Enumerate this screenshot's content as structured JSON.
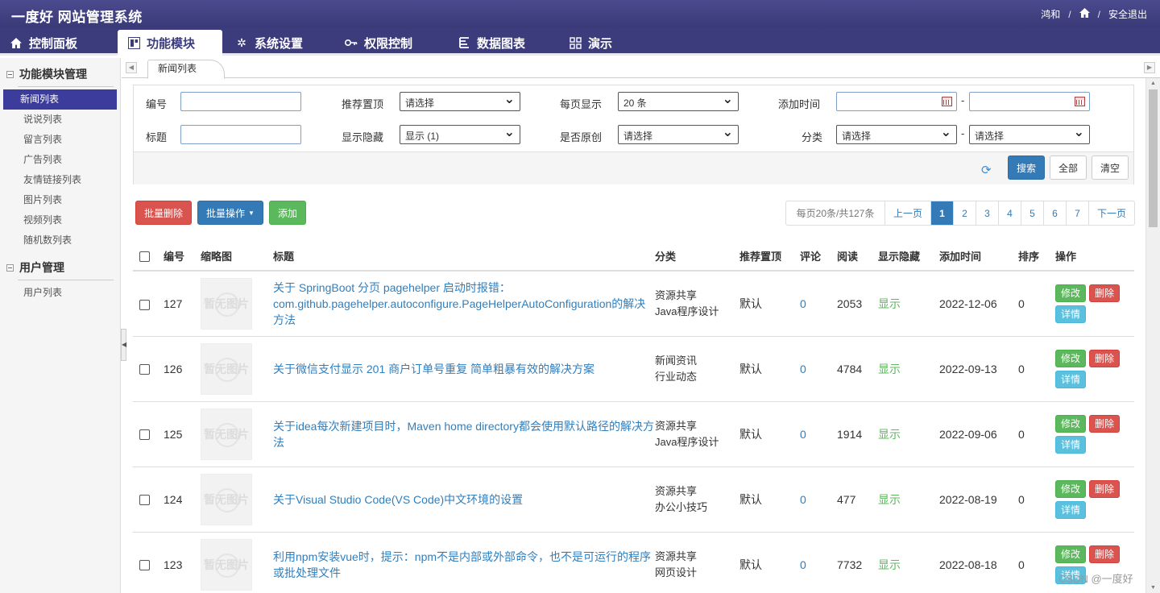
{
  "header": {
    "brand": "一度好 网站管理系统",
    "user": "鸿和",
    "sep1": "/",
    "sep2": "/",
    "logout": "安全退出"
  },
  "nav": {
    "tabs": [
      {
        "label": "控制面板",
        "icon": "home-icon"
      },
      {
        "label": "功能模块",
        "icon": "grid-icon"
      },
      {
        "label": "系统设置",
        "icon": "gear-icon"
      },
      {
        "label": "权限控制",
        "icon": "key-icon"
      },
      {
        "label": "数据图表",
        "icon": "list-icon"
      },
      {
        "label": "演示",
        "icon": "grid-icon"
      }
    ]
  },
  "sidebar": {
    "group1": "功能模块管理",
    "items1": [
      "新闻列表",
      "说说列表",
      "留言列表",
      "广告列表",
      "友情链接列表",
      "图片列表",
      "视频列表",
      "随机数列表"
    ],
    "group2": "用户管理",
    "items2": [
      "用户列表"
    ]
  },
  "tabstrip": {
    "page_tab": "新闻列表"
  },
  "search": {
    "id_label": "编号",
    "recommend_label": "推荐置顶",
    "recommend_value": "请选择",
    "perpage_label": "每页显示",
    "perpage_value": "20 条",
    "addtime_label": "添加时间",
    "dash1": "-",
    "title_label": "标题",
    "visible_label": "显示隐藏",
    "visible_value": "显示 (1)",
    "original_label": "是否原创",
    "original_value": "请选择",
    "category_label": "分类",
    "category1_value": "请选择",
    "dash2": "-",
    "category2_value": "请选择",
    "search_btn": "搜索",
    "all_btn": "全部",
    "clear_btn": "清空"
  },
  "actions": {
    "batch_delete": "批量删除",
    "batch_ops": "批量操作",
    "add": "添加"
  },
  "pager": {
    "info": "每页20条/共127条",
    "prev": "上一页",
    "pages": [
      "1",
      "2",
      "3",
      "4",
      "5",
      "6",
      "7"
    ],
    "next": "下一页"
  },
  "table": {
    "headers": [
      "编号",
      "缩略图",
      "标题",
      "分类",
      "推荐置顶",
      "评论",
      "阅读",
      "显示隐藏",
      "添加时间",
      "排序",
      "操作"
    ],
    "placeholder": "暂无图片",
    "rows": [
      {
        "id": "127",
        "title": "关于 SpringBoot 分页 pagehelper 启动时报错：com.github.pagehelper.autoconfigure.PageHelperAutoConfiguration的解决方法",
        "cat1": "资源共享",
        "cat2": "Java程序设计",
        "recommend": "默认",
        "comments": "0",
        "reads": "2053",
        "visible": "显示",
        "date": "2022-12-06",
        "sort": "0"
      },
      {
        "id": "126",
        "title": "关于微信支付显示 201 商户订单号重复 简单粗暴有效的解决方案",
        "cat1": "新闻资讯",
        "cat2": "行业动态",
        "recommend": "默认",
        "comments": "0",
        "reads": "4784",
        "visible": "显示",
        "date": "2022-09-13",
        "sort": "0"
      },
      {
        "id": "125",
        "title": "关于idea每次新建项目时，Maven home directory都会使用默认路径的解决方法",
        "cat1": "资源共享",
        "cat2": "Java程序设计",
        "recommend": "默认",
        "comments": "0",
        "reads": "1914",
        "visible": "显示",
        "date": "2022-09-06",
        "sort": "0"
      },
      {
        "id": "124",
        "title": "关于Visual Studio Code(VS Code)中文环境的设置",
        "cat1": "资源共享",
        "cat2": "办公小技巧",
        "recommend": "默认",
        "comments": "0",
        "reads": "477",
        "visible": "显示",
        "date": "2022-08-19",
        "sort": "0"
      },
      {
        "id": "123",
        "title": "利用npm安装vue时，提示：npm不是内部或外部命令，也不是可运行的程序或批处理文件",
        "cat1": "资源共享",
        "cat2": "网页设计",
        "recommend": "默认",
        "comments": "0",
        "reads": "7732",
        "visible": "显示",
        "date": "2022-08-18",
        "sort": "0"
      }
    ],
    "op_edit": "修改",
    "op_delete": "删除",
    "op_detail": "详情"
  },
  "watermark": "CSDN @一度好"
}
